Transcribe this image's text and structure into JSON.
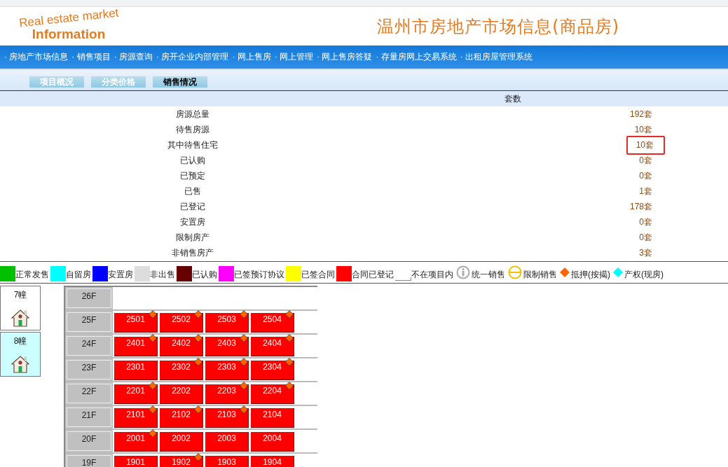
{
  "logo": {
    "arc_text": "Real estate market",
    "word": "Information"
  },
  "site_title": "温州市房地产市场信息(商品房)",
  "nav": [
    "· 房地产市场信息",
    "· 销售项目",
    "· 房源查询",
    "· 房开企业内部管理",
    "· 网上售房",
    "· 网上管理",
    "· 网上售房答疑",
    "· 存量房网上交易系统",
    "· 出租房屋管理系统"
  ],
  "tabs": [
    {
      "label": "项目概况",
      "selected": false
    },
    {
      "label": "分类价格",
      "selected": false
    },
    {
      "label": "销售情况",
      "selected": true
    }
  ],
  "summary": {
    "column": "套数",
    "rows": [
      {
        "label": "房源总量",
        "value": "192套",
        "highlighted": false
      },
      {
        "label": "待售房源",
        "value": "10套",
        "highlighted": false
      },
      {
        "label": "其中待售住宅",
        "value": "10套",
        "highlighted": true
      },
      {
        "label": "已认购",
        "value": "0套",
        "highlighted": false
      },
      {
        "label": "已预定",
        "value": "0套",
        "highlighted": false
      },
      {
        "label": "已售",
        "value": "1套",
        "highlighted": false
      },
      {
        "label": "已登记",
        "value": "178套",
        "highlighted": false
      },
      {
        "label": "安置房",
        "value": "0套",
        "highlighted": false
      },
      {
        "label": "限制房产",
        "value": "0套",
        "highlighted": false
      },
      {
        "label": "非销售房产",
        "value": "3套",
        "highlighted": false
      }
    ]
  },
  "legend": [
    {
      "kind": "swatch",
      "color": "#00c000",
      "label": "正常发售"
    },
    {
      "kind": "swatch",
      "color": "#00ffff",
      "label": "自留房"
    },
    {
      "kind": "swatch",
      "color": "#0000ff",
      "label": "安置房"
    },
    {
      "kind": "swatch",
      "color": "#dddddd",
      "label": "非出售"
    },
    {
      "kind": "swatch",
      "color": "#660000",
      "label": "已认购"
    },
    {
      "kind": "swatch",
      "color": "#ff00ff",
      "label": "已签预订协议"
    },
    {
      "kind": "swatch",
      "color": "#ffff00",
      "label": "已签合同"
    },
    {
      "kind": "swatch",
      "color": "#ff0000",
      "label": "合同已登记"
    },
    {
      "kind": "blank",
      "label": "不在项目内"
    },
    {
      "kind": "info",
      "label": "统一销售"
    },
    {
      "kind": "limit",
      "label": "限制销售"
    },
    {
      "kind": "diamond",
      "color": "#ff6600",
      "label": "抵押(按揭)"
    },
    {
      "kind": "diamond",
      "color": "#00ffff",
      "label": "产权(现房)"
    }
  ],
  "buildings": [
    {
      "label": "7幢",
      "selected": false
    },
    {
      "label": "8幢",
      "selected": true
    }
  ],
  "floors": [
    {
      "label": "26F"
    },
    {
      "label": "25F",
      "units": [
        {
          "number": "2501",
          "mortgaged": true
        },
        {
          "number": "2502",
          "mortgaged": true
        },
        {
          "number": "2503",
          "mortgaged": true
        },
        {
          "number": "2504",
          "mortgaged": true
        }
      ]
    },
    {
      "label": "24F",
      "units": [
        {
          "number": "2401",
          "mortgaged": true
        },
        {
          "number": "2402",
          "mortgaged": true
        },
        {
          "number": "2403",
          "mortgaged": true
        },
        {
          "number": "2404",
          "mortgaged": true
        }
      ]
    },
    {
      "label": "23F",
      "units": [
        {
          "number": "2301",
          "mortgaged": false
        },
        {
          "number": "2302",
          "mortgaged": true
        },
        {
          "number": "2303",
          "mortgaged": true
        },
        {
          "number": "2304",
          "mortgaged": true
        }
      ]
    },
    {
      "label": "22F",
      "units": [
        {
          "number": "2201",
          "mortgaged": true
        },
        {
          "number": "2202",
          "mortgaged": false
        },
        {
          "number": "2203",
          "mortgaged": true
        },
        {
          "number": "2204",
          "mortgaged": true
        }
      ]
    },
    {
      "label": "21F",
      "units": [
        {
          "number": "2101",
          "mortgaged": true
        },
        {
          "number": "2102",
          "mortgaged": true
        },
        {
          "number": "2103",
          "mortgaged": true
        },
        {
          "number": "2104",
          "mortgaged": false
        }
      ]
    },
    {
      "label": "20F",
      "units": [
        {
          "number": "2001",
          "mortgaged": true
        },
        {
          "number": "2002",
          "mortgaged": false
        },
        {
          "number": "2003",
          "mortgaged": false
        },
        {
          "number": "2004",
          "mortgaged": false
        }
      ]
    },
    {
      "label": "19F",
      "units": [
        {
          "number": "1901",
          "mortgaged": false
        },
        {
          "number": "1902",
          "mortgaged": true
        },
        {
          "number": "1903",
          "mortgaged": false
        },
        {
          "number": "1904",
          "mortgaged": false
        }
      ]
    }
  ]
}
